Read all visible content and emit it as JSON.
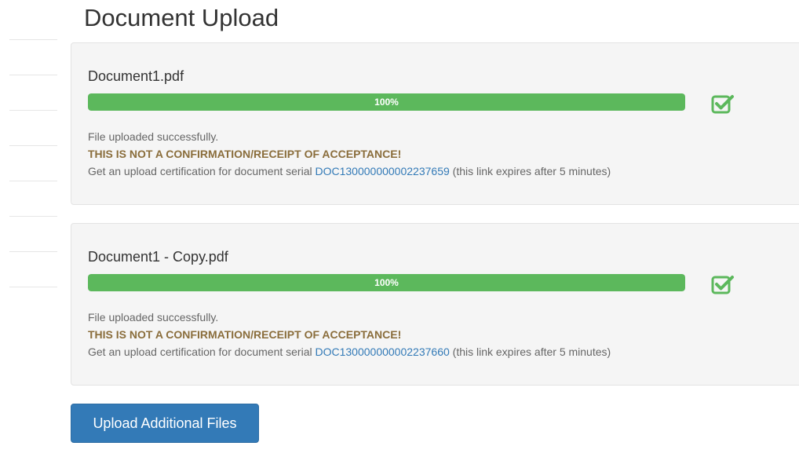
{
  "page": {
    "title": "Document Upload"
  },
  "uploads": [
    {
      "file_name": "Document1.pdf",
      "progress": 100,
      "progress_label": "100%",
      "status_text": "File uploaded successfully.",
      "warning_text": "THIS IS NOT A CONFIRMATION/RECEIPT OF ACCEPTANCE!",
      "cert_prefix": "Get an upload certification for document serial ",
      "serial": "DOC130000000002237659",
      "cert_suffix": " (this link expires after 5 minutes)"
    },
    {
      "file_name": "Document1 - Copy.pdf",
      "progress": 100,
      "progress_label": "100%",
      "status_text": "File uploaded successfully.",
      "warning_text": "THIS IS NOT A CONFIRMATION/RECEIPT OF ACCEPTANCE!",
      "cert_prefix": "Get an upload certification for document serial ",
      "serial": "DOC130000000002237660",
      "cert_suffix": " (this link expires after 5 minutes)"
    }
  ],
  "actions": {
    "upload_additional_label": "Upload Additional Files"
  },
  "icons": {
    "upload_complete": "checkbox-checked-icon"
  },
  "colors": {
    "progress_success": "#5cb85c",
    "check_icon": "#5cb85c",
    "primary_button": "#337ab7",
    "link": "#337ab7",
    "warning_text": "#8a6d3b"
  }
}
